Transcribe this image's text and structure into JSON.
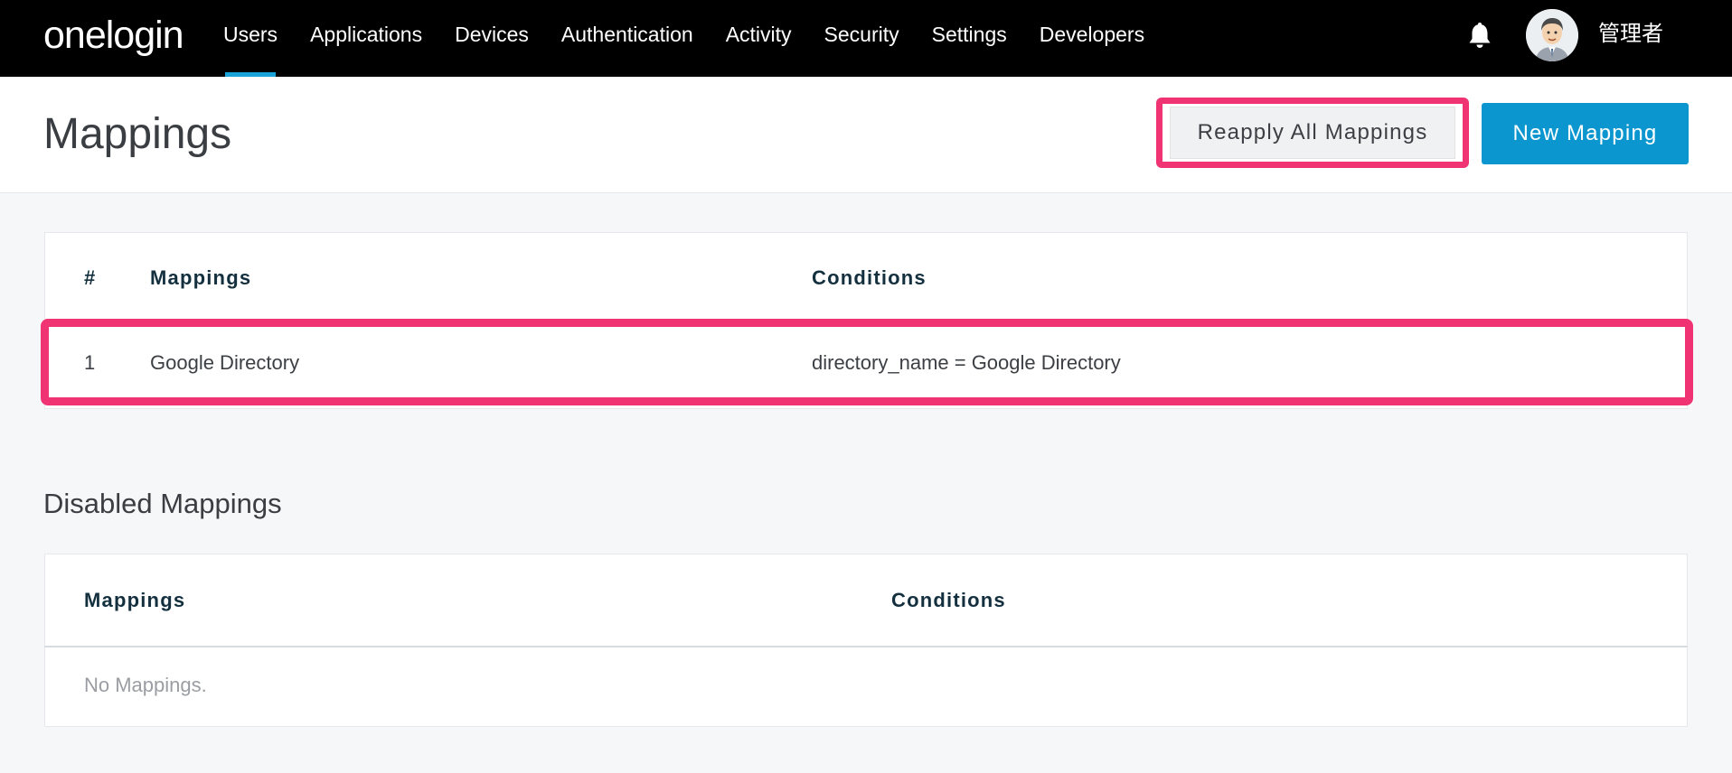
{
  "app": {
    "logo_text": "onelogin"
  },
  "nav": {
    "items": [
      {
        "label": "Users",
        "active": true
      },
      {
        "label": "Applications"
      },
      {
        "label": "Devices"
      },
      {
        "label": "Authentication"
      },
      {
        "label": "Activity"
      },
      {
        "label": "Security"
      },
      {
        "label": "Settings"
      },
      {
        "label": "Developers"
      }
    ],
    "user_name": "管理者",
    "bell_icon": "bell-icon",
    "avatar_icon": "avatar-icon"
  },
  "page": {
    "title": "Mappings",
    "reapply_label": "Reapply All Mappings",
    "new_label": "New Mapping"
  },
  "mappings_table": {
    "headers": {
      "num": "#",
      "mappings": "Mappings",
      "conditions": "Conditions"
    },
    "rows": [
      {
        "num": "1",
        "mapping": "Google Directory",
        "condition": "directory_name = Google Directory"
      }
    ]
  },
  "disabled": {
    "title": "Disabled Mappings",
    "headers": {
      "mappings": "Mappings",
      "conditions": "Conditions"
    },
    "empty_text": "No Mappings."
  },
  "colors": {
    "highlight": "#f03372",
    "primary": "#0c96cf",
    "nav_active": "#1aa3d9"
  }
}
